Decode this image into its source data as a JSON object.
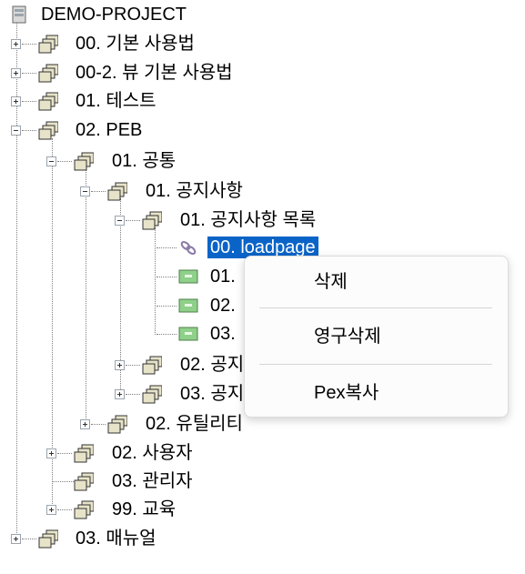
{
  "tree": {
    "root": "DEMO-PROJECT",
    "nodes": [
      {
        "label": "00. 기본 사용법"
      },
      {
        "label": "00-2. 뷰 기본 사용법"
      },
      {
        "label": "01. 테스트"
      },
      {
        "label": "02. PEB"
      },
      {
        "label": "01. 공통"
      },
      {
        "label": "01. 공지사항"
      },
      {
        "label": "01. 공지사항 목록"
      },
      {
        "label": "00. loadpage"
      },
      {
        "label": "01."
      },
      {
        "label": "02."
      },
      {
        "label": "03."
      },
      {
        "label": "02. 공지"
      },
      {
        "label": "03. 공지"
      },
      {
        "label": "02. 유틸리티"
      },
      {
        "label": "02. 사용자"
      },
      {
        "label": "03. 관리자"
      },
      {
        "label": "99. 교육"
      },
      {
        "label": "03. 매뉴얼"
      }
    ]
  },
  "context_menu": {
    "items": [
      "삭제",
      "영구삭제",
      "Pex복사"
    ]
  },
  "colors": {
    "selection": "#0a64c8",
    "folder_fill": "#e7e3c9",
    "page_fill": "#8fd08a"
  }
}
